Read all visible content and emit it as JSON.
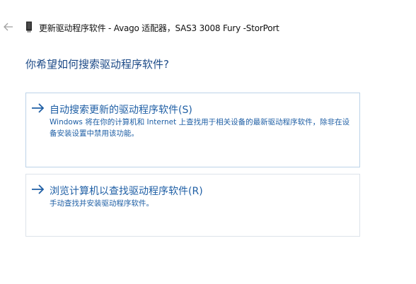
{
  "header": {
    "back_icon": "back-arrow-icon",
    "device_icon": "storage-controller-icon",
    "title": "更新驱动程序软件 - Avago 适配器，SAS3 3008 Fury -StorPort"
  },
  "question": "你希望如何搜索驱动程序软件?",
  "options": [
    {
      "icon": "arrow-right-icon",
      "title": "自动搜索更新的驱动程序软件(S)",
      "description": "Windows 将在你的计算机和 Internet 上查找用于相关设备的最新驱动程序软件，除非在设备安装设置中禁用该功能。"
    },
    {
      "icon": "arrow-right-icon",
      "title": "浏览计算机以查找驱动程序软件(R)",
      "description": "手动查找并安装驱动程序软件。"
    }
  ],
  "colors": {
    "accent": "#1f5fa5",
    "heading": "#1c4a87",
    "border": "#cfdbe7"
  }
}
